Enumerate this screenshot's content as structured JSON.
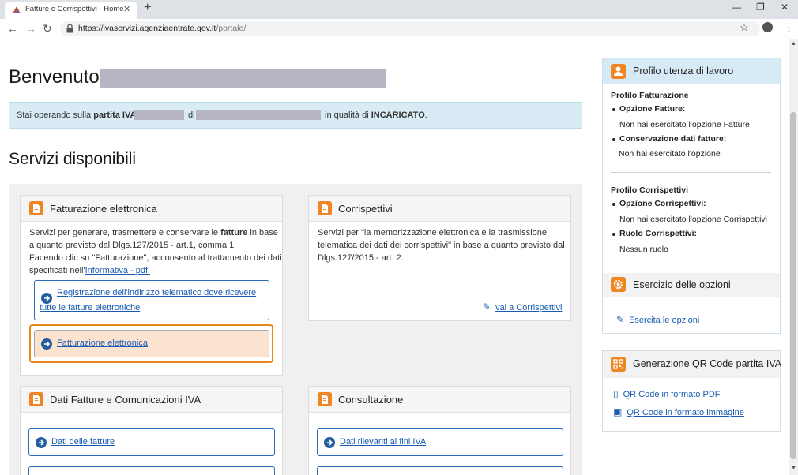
{
  "browser": {
    "tab_title": "Fatture e Corrispettivi - Home",
    "tab_close": "✕",
    "new_tab": "+",
    "win_min": "—",
    "win_max": "❐",
    "win_close": "✕",
    "url_host": "https://ivaservizi.agenziaentrate.gov.it",
    "url_path": "/portale/",
    "back": "←",
    "forward": "→",
    "reload": "↻",
    "star": "☆",
    "menu": "⋮",
    "icons": [
      "favicon-icon",
      "lock-icon",
      "star-icon",
      "profile-icon",
      "menu-icon"
    ]
  },
  "welcome": {
    "text": "Benvenuto,"
  },
  "alert": {
    "part1": "Stai operando sulla ",
    "part_bold1": "partita IVA",
    "part2": "di",
    "part3": "in qualità di ",
    "part_bold2": "INCARICATO",
    "part4": "."
  },
  "services": {
    "title": "Servizi disponibili"
  },
  "fatturazione": {
    "title": "Fatturazione elettronica",
    "line1_a": "Servizi per generare, trasmettere e conservare le ",
    "line1_b": "fatture",
    "line1_c": " in base",
    "line2": "a quanto previsto dal Dlgs.127/2015 - art.1, comma 1",
    "line3": "Facendo clic su \"Fatturazione\", acconsento al trattamento dei dati",
    "line4_a": "specificati nell'",
    "line4_link": "Informativa - pdf.",
    "btn1_line1": "Registrazione dell'indirizzo telematico dove ricevere",
    "btn1_line2": "tutte le fatture elettroniche",
    "btn2": "Fatturazione elettronica"
  },
  "corrispettivi": {
    "title": "Corrispettivi",
    "line1": "Servizi per \"la memorizzazione elettronica e la trasmissione",
    "line2": "telematica dei dati dei corrispettivi\" in base a quanto previsto dal",
    "line3": "Dlgs.127/2015 - art. 2.",
    "link": "vai a Corrispettivi"
  },
  "dati_fatture": {
    "title": "Dati Fatture e Comunicazioni IVA",
    "btn1": "Dati delle fatture"
  },
  "consultazione": {
    "title": "Consultazione",
    "btn1": "Dati rilevanti ai fini IVA"
  },
  "profilo": {
    "title": "Profilo utenza di lavoro",
    "fatt_head": "Profilo Fatturazione",
    "opz_fatt_label": "Opzione Fatture:",
    "opz_fatt_value": "Non hai esercitato l'opzione Fatture",
    "cons_label": "Conservazione dati fatture:",
    "cons_value": "Non hai esercitato l'opzione",
    "corr_head": "Profilo Corrispettivi",
    "opz_corr_label": "Opzione Corrispettivi:",
    "opz_corr_value": "Non hai esercitato l'opzione Corrispettivi",
    "ruolo_label": "Ruolo Corrispettivi:",
    "ruolo_value": "Nessun ruolo",
    "esercizio_title": "Esercizio delle opzioni",
    "esercizio_link": "Esercita le opzioni"
  },
  "qrcode": {
    "title": "Generazione QR Code partita IVA",
    "link_pdf": "QR Code in formato PDF",
    "link_img": "QR Code in formato immagine"
  },
  "colors": {
    "accent_orange": "#ef8623",
    "link_blue": "#1a5bb0",
    "alert_bg": "#d9ecf5",
    "panel_head_bg": "#d6eaf5",
    "highlight_bg": "#fbe3d0"
  }
}
